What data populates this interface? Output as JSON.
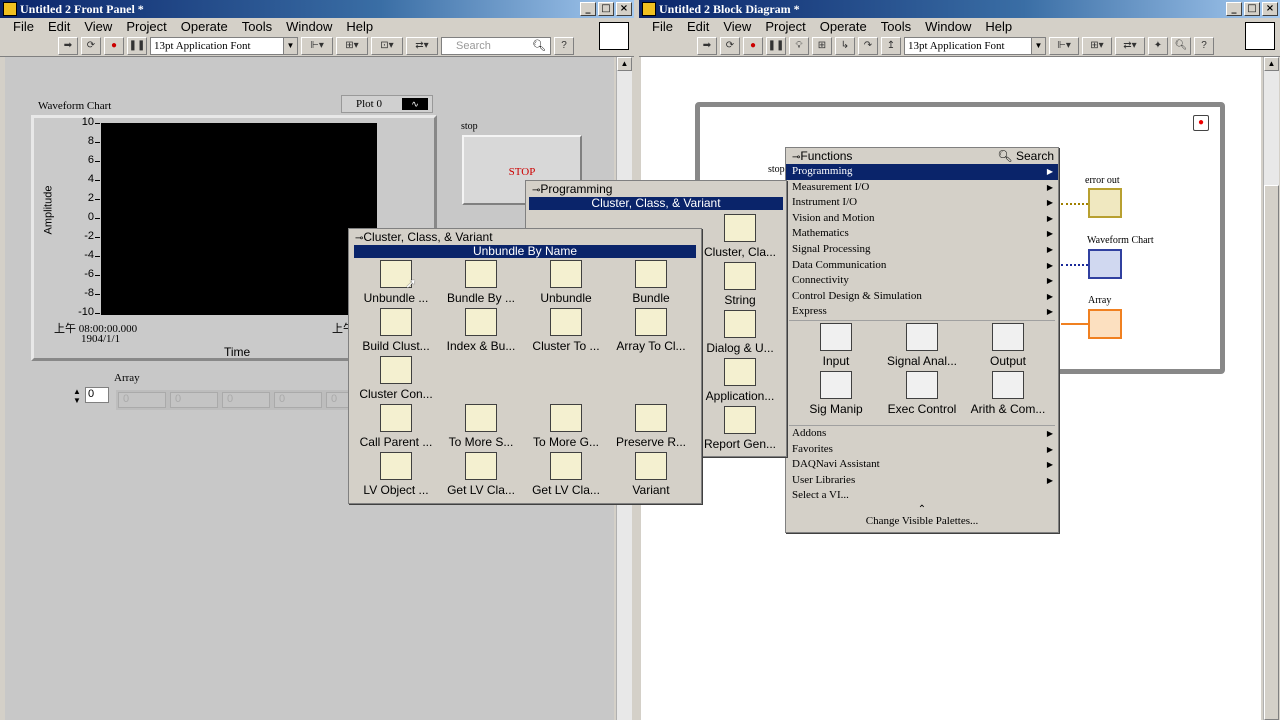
{
  "front_panel": {
    "title": "Untitled 2 Front Panel *",
    "menu": [
      "File",
      "Edit",
      "View",
      "Project",
      "Operate",
      "Tools",
      "Window",
      "Help"
    ],
    "font": "13pt Application Font",
    "search_placeholder": "Search",
    "chart": {
      "label": "Waveform Chart",
      "plot_legend": "Plot 0",
      "y_axis_label": "Amplitude",
      "y_ticks": [
        "10",
        "8",
        "6",
        "4",
        "2",
        "0",
        "-2",
        "-4",
        "-6",
        "-8",
        "-10"
      ],
      "x_axis_label": "Time",
      "x_tick_start": "上午 08:00:00.000",
      "x_tick_date": "1904/1/1",
      "x_tick_end": "上午"
    },
    "stop": {
      "label": "stop",
      "button": "STOP"
    },
    "array": {
      "label": "Array",
      "index": "0",
      "values": [
        "0",
        "0",
        "0",
        "0",
        "0"
      ]
    }
  },
  "block_diagram": {
    "title": "Untitled 2 Block Diagram *",
    "menu": [
      "File",
      "Edit",
      "View",
      "Project",
      "Operate",
      "Tools",
      "Window",
      "Help"
    ],
    "font": "13pt Application Font",
    "terminals": {
      "stop": "stop",
      "error_out": "error out",
      "waveform_chart": "Waveform Chart",
      "array": "Array"
    }
  },
  "functions_palette": {
    "title": "Functions",
    "search": "Search",
    "items": [
      {
        "label": "Programming",
        "sel": true
      },
      {
        "label": "Measurement I/O"
      },
      {
        "label": "Instrument I/O"
      },
      {
        "label": "Vision and Motion"
      },
      {
        "label": "Mathematics"
      },
      {
        "label": "Signal Processing"
      },
      {
        "label": "Data Communication"
      },
      {
        "label": "Connectivity"
      },
      {
        "label": "Control Design & Simulation"
      },
      {
        "label": "Express"
      }
    ],
    "express_icons": [
      "Input",
      "Signal Anal...",
      "Output",
      "Sig Manip",
      "Exec Control",
      "Arith & Com..."
    ],
    "more_items": [
      {
        "label": "Addons"
      },
      {
        "label": "Favorites"
      },
      {
        "label": "DAQNavi Assistant"
      },
      {
        "label": "User Libraries"
      },
      {
        "label": "Select a VI..."
      }
    ],
    "footer": "Change Visible Palettes..."
  },
  "programming_palette": {
    "title": "Programming",
    "selected": "Cluster, Class, & Variant",
    "icons": [
      "Cluster, Cla...",
      "String",
      "Dialog & U...",
      "Application...",
      "Report Gen..."
    ]
  },
  "cluster_palette": {
    "title": "Cluster, Class, & Variant",
    "selected": "Unbundle By Name",
    "icons": [
      "Unbundle ...",
      "Bundle By ...",
      "Unbundle",
      "Bundle",
      "Build Clust...",
      "Index & Bu...",
      "Cluster To ...",
      "Array To Cl...",
      "Cluster Con...",
      "Call Parent ...",
      "To More S...",
      "To More G...",
      "Preserve R...",
      "LV Object ...",
      "Get LV Cla...",
      "Get LV Cla...",
      "Variant"
    ]
  }
}
